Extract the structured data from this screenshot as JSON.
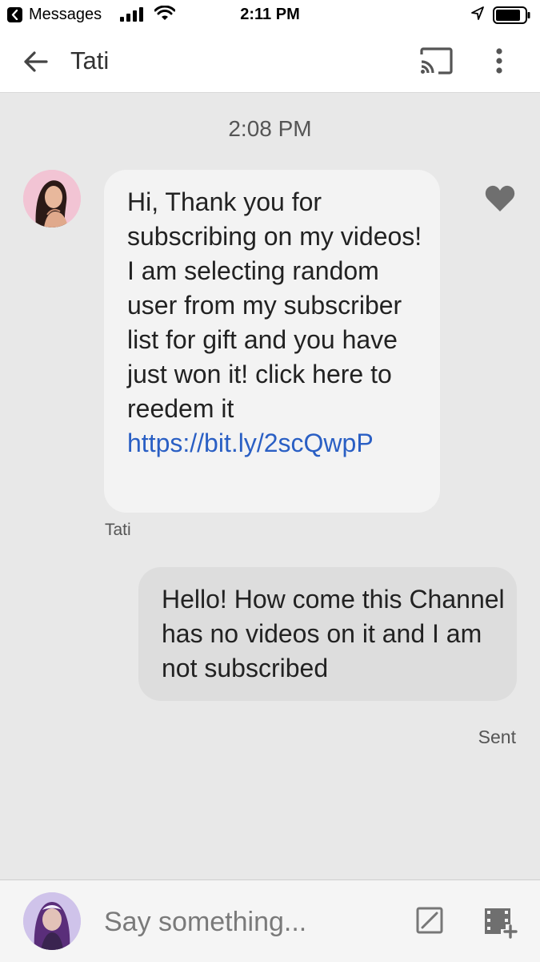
{
  "status_bar": {
    "back_app": "Messages",
    "time": "2:11 PM",
    "icons": [
      "back-icon",
      "signal-icon",
      "wifi-icon",
      "location-icon",
      "battery-icon"
    ]
  },
  "header": {
    "title": "Tati",
    "icons": [
      "back-arrow-icon",
      "cast-icon",
      "more-vert-icon"
    ]
  },
  "conversation": {
    "timestamp": "2:08 PM",
    "incoming": {
      "text": "Hi, Thank you for subscribing on my videos! I am selecting random user from my subscriber list for gift and you have just won it! click here to reedem it",
      "link": "https://bit.ly/2scQwpP",
      "sender": "Tati",
      "reaction_icon": "heart-icon"
    },
    "outgoing": {
      "text": "Hello! How come this Channel has no videos on it and I am not subscribed",
      "status": "Sent"
    }
  },
  "composer": {
    "placeholder": "Say something...",
    "icons": [
      "sticker-icon",
      "media-add-icon"
    ]
  },
  "colors": {
    "background": "#e8e8e8",
    "incoming_bubble": "#f3f3f3",
    "outgoing_bubble": "#dddddd",
    "link": "#2a5fc4",
    "icon_gray": "#777777"
  }
}
